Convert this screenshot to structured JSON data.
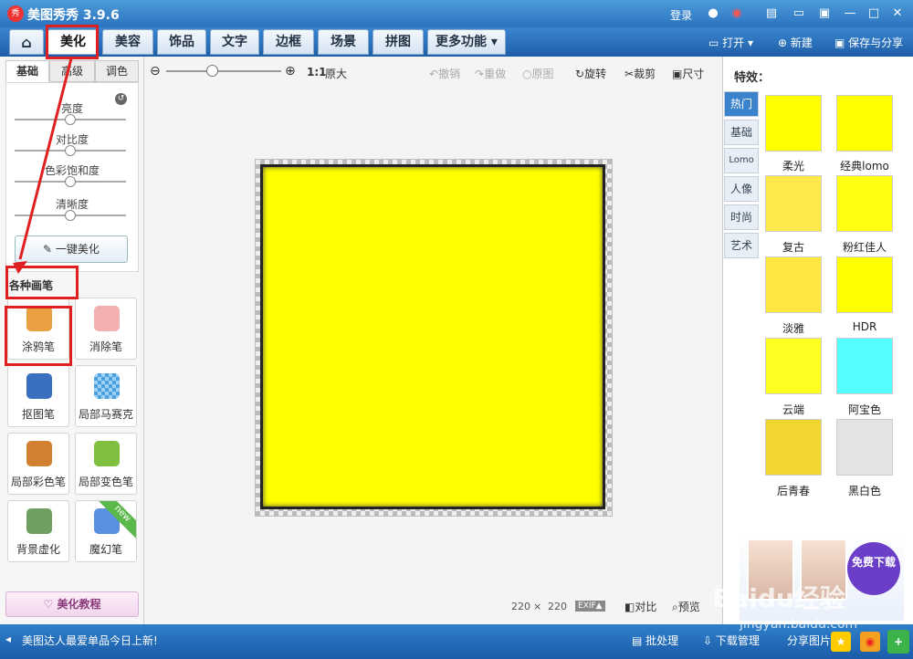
{
  "titlebar": {
    "app": "美图秀秀 3.9.6",
    "login": "登录",
    "logo": "秀"
  },
  "tabs": [
    {
      "label": "美化"
    },
    {
      "label": "美容"
    },
    {
      "label": "饰品"
    },
    {
      "label": "文字"
    },
    {
      "label": "边框"
    },
    {
      "label": "场景"
    },
    {
      "label": "拼图"
    },
    {
      "label": "更多功能 ▾"
    }
  ],
  "actions": {
    "open": "打开",
    "new": "新建",
    "save": "保存与分享"
  },
  "left": {
    "subtabs": [
      "基础",
      "高级",
      "调色"
    ],
    "sliders": [
      "亮度",
      "对比度",
      "色彩饱和度",
      "清晰度"
    ],
    "oneclick": "一键美化",
    "brush_title": "各种画笔",
    "brushes": [
      {
        "label": "涂鸦笔",
        "color": "#e8a040"
      },
      {
        "label": "消除笔",
        "color": "#f2b0b0"
      },
      {
        "label": "抠图笔",
        "color": "#3a70c0"
      },
      {
        "label": "局部马赛克",
        "color": "#4aa0e0"
      },
      {
        "label": "局部彩色笔",
        "color": "#d08030"
      },
      {
        "label": "局部变色笔",
        "color": "#80c040"
      },
      {
        "label": "背景虚化",
        "color": "#70a060"
      },
      {
        "label": "魔幻笔",
        "color": "#5a90e0"
      }
    ],
    "new_badge": "new",
    "tutorial": "美化教程"
  },
  "toolbar2": {
    "zoom_label": "1:1",
    "original_size": "原大",
    "undo": "撤销",
    "redo": "重做",
    "original": "原图",
    "rotate": "旋转",
    "crop": "裁剪",
    "size": "尺寸"
  },
  "canvas": {
    "width": "220",
    "times": "×",
    "height": "220",
    "exif": "EXIF▲",
    "compare": "对比",
    "preview": "预览"
  },
  "right": {
    "title": "特效：",
    "ftabs": [
      "热门",
      "基础",
      "Lomo",
      "人像",
      "时尚",
      "艺术"
    ],
    "effects": [
      {
        "label": "柔光",
        "color": "#ffff00"
      },
      {
        "label": "经典lomo",
        "color": "#ffff00"
      },
      {
        "label": "复古",
        "color": "#ffe94a"
      },
      {
        "label": "粉红佳人",
        "color": "#ffff10"
      },
      {
        "label": "淡雅",
        "color": "#ffe640"
      },
      {
        "label": "HDR",
        "color": "#ffff00"
      },
      {
        "label": "云端",
        "color": "#ffff22"
      },
      {
        "label": "阿宝色",
        "color": "#55ffff"
      },
      {
        "label": "后青春",
        "color": "#f2d630"
      },
      {
        "label": "黑白色",
        "color": "#e3e3e3"
      }
    ],
    "ad_btn": "免费下载"
  },
  "status": {
    "news": "美图达人最爱单品今日上新!",
    "batch": "批处理",
    "download": "下载管理",
    "share": "分享图片"
  },
  "watermark": "Baidu经验",
  "watermark2": "jingyan.baidu.com"
}
